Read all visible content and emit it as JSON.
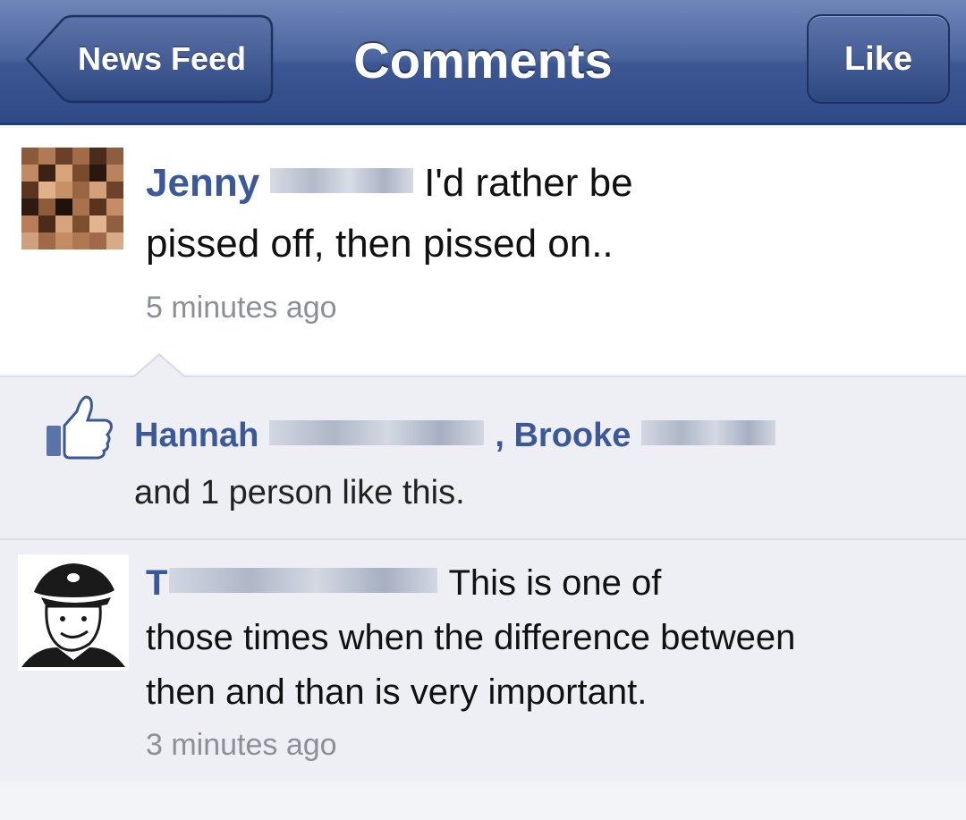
{
  "header": {
    "back_label": "News Feed",
    "title": "Comments",
    "like_label": "Like",
    "bar_color": "#3c5794"
  },
  "post": {
    "author_first": "Jenny",
    "text_line1": "I'd rather be",
    "text_line2": "pissed off, then pissed on..",
    "timestamp": "5 minutes ago"
  },
  "likes": {
    "icon": "thumbs-up-icon",
    "name1": "Hannah",
    "separator": ",",
    "name2": "Brooke",
    "rest": "and 1 person like this."
  },
  "reply": {
    "author_initial": "T",
    "text_line1": "This is one of",
    "text_line2": "those times when the difference between",
    "text_line3": "then and than is very important.",
    "timestamp": "3 minutes ago"
  },
  "colors": {
    "link": "#3b5998",
    "timestamp": "#8b8f97",
    "panel": "#edeff4"
  }
}
